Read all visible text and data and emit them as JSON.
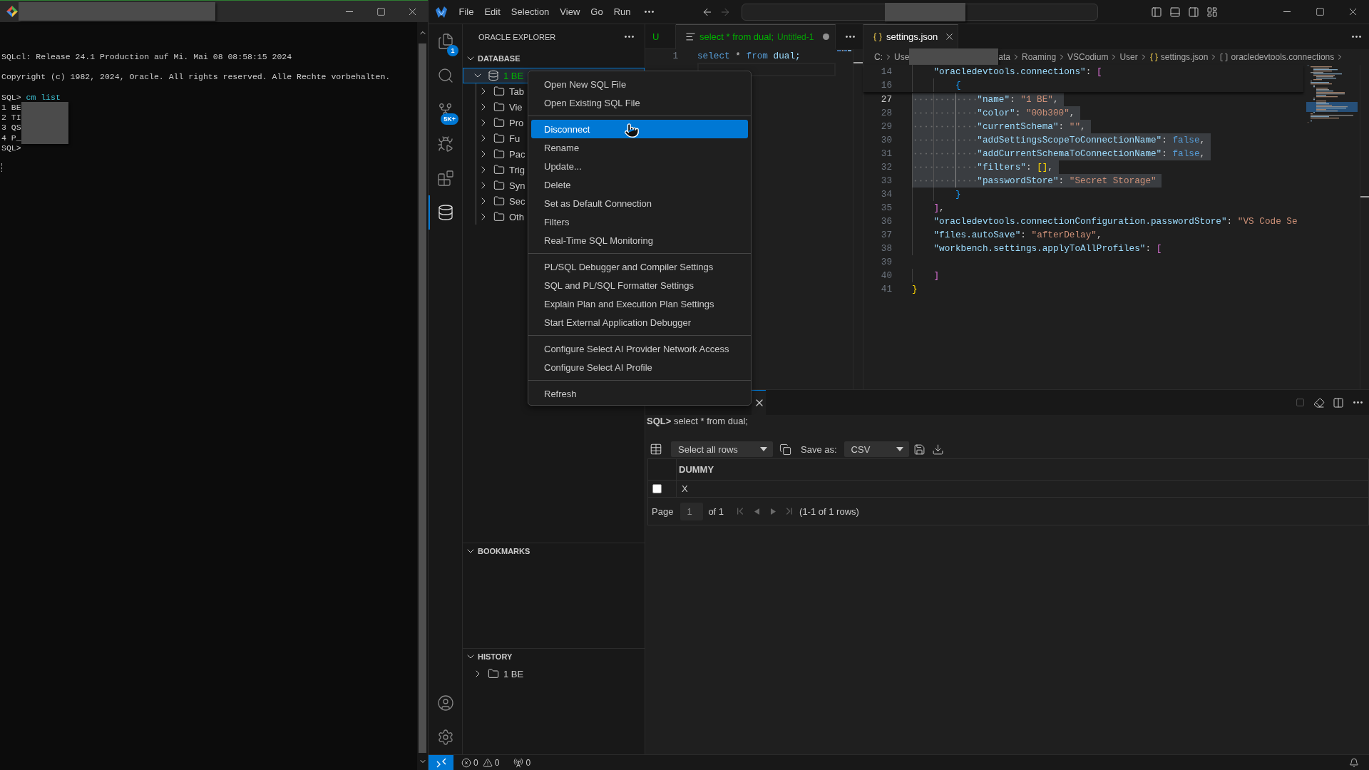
{
  "terminal": {
    "blocks": [
      {
        "lines": [
          {
            "kind": "output",
            "text": "SQLcl: Release 24.1 Production auf Mi. Mai 08 08:58:15 2024",
            "redacted": false
          }
        ]
      },
      {
        "lines": [
          {
            "kind": "output",
            "text": "Copyright (c) 1982, 2024, Oracle. All rights reserved. Alle Rechte vorbehalten.",
            "redacted": false
          }
        ]
      },
      {
        "lines": [
          {
            "kind": "prompt",
            "prompt": "SQL>",
            "command": "cm list",
            "redacted": false
          },
          {
            "kind": "output",
            "text": "1 BE",
            "redacted": true
          },
          {
            "kind": "output",
            "text": "2 TI",
            "redacted": true
          },
          {
            "kind": "output",
            "text": "3 QS",
            "redacted": true
          },
          {
            "kind": "output",
            "text": "4 P_",
            "redacted": true
          },
          {
            "kind": "prompt",
            "prompt": "SQL>",
            "redacted": false
          }
        ]
      }
    ]
  },
  "vscode": {
    "menu": [
      "File",
      "Edit",
      "Selection",
      "View",
      "Go",
      "Run"
    ],
    "activity_bar": [
      {
        "kind": "explorer",
        "badge": "1",
        "selected": false
      },
      {
        "kind": "search",
        "selected": false
      },
      {
        "kind": "source-control",
        "badge": "5K+",
        "selected": false
      },
      {
        "kind": "run-debug",
        "selected": false
      },
      {
        "kind": "extensions",
        "selected": false
      },
      {
        "kind": "database",
        "selected": true
      }
    ],
    "activity_bar_bottom": [
      {
        "kind": "account"
      },
      {
        "kind": "settings"
      }
    ],
    "sidebar": {
      "title": "ORACLE EXPLORER",
      "sections": [
        {
          "title": "DATABASE",
          "expanded": true,
          "tree": [
            {
              "kind": "connection",
              "label": "1 BE",
              "color": "#00b300",
              "selected": true,
              "expanded": true,
              "children": [
                {
                  "kind": "folder",
                  "label": "Tab",
                  "selected": false,
                  "expanded": false
                },
                {
                  "kind": "folder",
                  "label": "Vie",
                  "selected": false,
                  "expanded": false
                },
                {
                  "kind": "folder",
                  "label": "Pro",
                  "selected": false,
                  "expanded": false
                },
                {
                  "kind": "folder",
                  "label": "Fu",
                  "selected": false,
                  "expanded": false
                },
                {
                  "kind": "folder",
                  "label": "Pac",
                  "selected": false,
                  "expanded": false
                },
                {
                  "kind": "folder",
                  "label": "Trig",
                  "selected": false,
                  "expanded": false
                },
                {
                  "kind": "folder",
                  "label": "Syn",
                  "selected": false,
                  "expanded": false
                },
                {
                  "kind": "folder",
                  "label": "Sec",
                  "selected": false,
                  "expanded": false
                },
                {
                  "kind": "folder",
                  "label": "Oth",
                  "selected": false,
                  "expanded": false
                }
              ]
            }
          ]
        },
        {
          "title": "BOOKMARKS",
          "expanded": true
        },
        {
          "title": "HISTORY",
          "expanded": true,
          "tree": [
            {
              "kind": "folder",
              "label": "1 BE",
              "selected": false,
              "expanded": false
            }
          ]
        }
      ]
    },
    "context_menu": {
      "groups": [
        {
          "items": [
            {
              "label": "Open New SQL File",
              "selected": false
            },
            {
              "label": "Open Existing SQL File",
              "selected": false
            }
          ]
        },
        {
          "items": [
            {
              "label": "Disconnect",
              "selected": true
            },
            {
              "label": "Rename",
              "selected": false
            },
            {
              "label": "Update...",
              "selected": false
            },
            {
              "label": "Delete",
              "selected": false
            },
            {
              "label": "Set as Default Connection",
              "selected": false
            },
            {
              "label": "Filters",
              "selected": false
            },
            {
              "label": "Real-Time SQL Monitoring",
              "selected": false
            }
          ]
        },
        {
          "items": [
            {
              "label": "PL/SQL Debugger and Compiler Settings",
              "selected": false
            },
            {
              "label": "SQL and PL/SQL Formatter Settings",
              "selected": false
            },
            {
              "label": "Explain Plan and Execution Plan Settings",
              "selected": false
            },
            {
              "label": "Start External Application Debugger",
              "selected": false
            }
          ]
        },
        {
          "items": [
            {
              "label": "Configure Select AI Provider Network Access",
              "selected": false
            },
            {
              "label": "Configure Select AI Profile",
              "selected": false
            }
          ]
        },
        {
          "items": [
            {
              "label": "Refresh",
              "selected": false
            }
          ]
        }
      ]
    },
    "editor_groups": [
      {
        "tabs": [
          {
            "kind": "partial",
            "label": "U",
            "color": "#00b300",
            "selected": false
          },
          {
            "kind": "sql",
            "label": "select * from dual;",
            "description": "Untitled-1",
            "color": "#00b300",
            "selected": true,
            "modified": true
          }
        ],
        "lines": [
          {
            "number": "1",
            "current": false,
            "selected": false,
            "tokens": [
              {
                "kind": "keyword",
                "text": "select"
              },
              {
                "kind": "plain",
                "text": " * "
              },
              {
                "kind": "keyword",
                "text": "from"
              },
              {
                "kind": "ident",
                "text": " dual;"
              }
            ]
          },
          {
            "current": true,
            "selected": false
          }
        ]
      },
      {
        "tabs": [
          {
            "kind": "json",
            "label": "settings.json",
            "selected": true,
            "modified": false
          }
        ],
        "breadcrumbs": [
          {
            "kind": "folder",
            "label": "C:",
            "redacted": false
          },
          {
            "kind": "folder",
            "label": "Use",
            "redacted": true,
            "tail": "ata"
          },
          {
            "kind": "folder",
            "label": "Roaming",
            "redacted": false
          },
          {
            "kind": "folder",
            "label": "VSCodium",
            "redacted": false
          },
          {
            "kind": "folder",
            "label": "User",
            "redacted": false
          },
          {
            "kind": "json",
            "label": "settings.json",
            "redacted": false
          },
          {
            "kind": "array",
            "label": "oracledevtools.connections",
            "redacted": false
          }
        ],
        "sticky_lines": [
          {
            "number": "14",
            "current": false,
            "selected": false,
            "tokens": [
              {
                "kind": "key",
                "text": "    \"oracledevtools.connections\""
              },
              {
                "kind": "punct",
                "text": ": "
              },
              {
                "kind": "bracket2",
                "text": "["
              }
            ]
          },
          {
            "number": "16",
            "current": false,
            "selected": false,
            "tokens": [
              {
                "kind": "bracket3",
                "text": "        {"
              }
            ]
          }
        ],
        "lines": [
          {
            "number": "27",
            "current": true,
            "selected": true,
            "tokens": [
              {
                "kind": "key",
                "text": "            \"name\""
              },
              {
                "kind": "punct",
                "text": ": "
              },
              {
                "kind": "string",
                "text": "\"1 BE\""
              },
              {
                "kind": "punct",
                "text": ","
              }
            ]
          },
          {
            "number": "28",
            "current": false,
            "selected": true,
            "tokens": [
              {
                "kind": "key",
                "text": "            \"color\""
              },
              {
                "kind": "punct",
                "text": ": "
              },
              {
                "kind": "string",
                "text": "\"00b300\""
              },
              {
                "kind": "punct",
                "text": ","
              }
            ]
          },
          {
            "number": "29",
            "current": false,
            "selected": true,
            "tokens": [
              {
                "kind": "key",
                "text": "            \"currentSchema\""
              },
              {
                "kind": "punct",
                "text": ": "
              },
              {
                "kind": "string",
                "text": "\"\""
              },
              {
                "kind": "punct",
                "text": ","
              }
            ]
          },
          {
            "number": "30",
            "current": false,
            "selected": true,
            "tokens": [
              {
                "kind": "key",
                "text": "            \"addSettingsScopeToConnectionName\""
              },
              {
                "kind": "punct",
                "text": ": "
              },
              {
                "kind": "bool",
                "text": "false"
              },
              {
                "kind": "punct",
                "text": ","
              }
            ]
          },
          {
            "number": "31",
            "current": false,
            "selected": true,
            "tokens": [
              {
                "kind": "key",
                "text": "            \"addCurrentSchemaToConnectionName\""
              },
              {
                "kind": "punct",
                "text": ": "
              },
              {
                "kind": "bool",
                "text": "false"
              },
              {
                "kind": "punct",
                "text": ","
              }
            ]
          },
          {
            "number": "32",
            "current": false,
            "selected": true,
            "tokens": [
              {
                "kind": "key",
                "text": "            \"filters\""
              },
              {
                "kind": "punct",
                "text": ": "
              },
              {
                "kind": "bracket1",
                "text": "[]"
              },
              {
                "kind": "punct",
                "text": ","
              }
            ]
          },
          {
            "number": "33",
            "current": false,
            "selected": true,
            "tokens": [
              {
                "kind": "key",
                "text": "            \"passwordStore\""
              },
              {
                "kind": "punct",
                "text": ": "
              },
              {
                "kind": "string",
                "text": "\"Secret Storage\""
              }
            ]
          },
          {
            "number": "34",
            "current": false,
            "selected": false,
            "tokens": [
              {
                "kind": "bracket3",
                "text": "        }"
              }
            ]
          },
          {
            "number": "35",
            "current": false,
            "selected": false,
            "tokens": [
              {
                "kind": "bracket2",
                "text": "    ]"
              },
              {
                "kind": "punct",
                "text": ","
              }
            ]
          },
          {
            "number": "36",
            "current": false,
            "selected": false,
            "tokens": [
              {
                "kind": "key",
                "text": "    \"oracledevtools.connectionConfiguration.passwordStore\""
              },
              {
                "kind": "punct",
                "text": ": "
              },
              {
                "kind": "string",
                "text": "\"VS Code Se"
              }
            ]
          },
          {
            "number": "37",
            "current": false,
            "selected": false,
            "tokens": [
              {
                "kind": "key",
                "text": "    \"files.autoSave\""
              },
              {
                "kind": "punct",
                "text": ": "
              },
              {
                "kind": "string",
                "text": "\"afterDelay\""
              },
              {
                "kind": "punct",
                "text": ","
              }
            ]
          },
          {
            "number": "38",
            "current": false,
            "selected": false,
            "tokens": [
              {
                "kind": "key",
                "text": "    \"workbench.settings.applyToAllProfiles\""
              },
              {
                "kind": "punct",
                "text": ": "
              },
              {
                "kind": "bracket2",
                "text": "["
              }
            ]
          },
          {
            "number": "39",
            "current": false,
            "selected": false
          },
          {
            "number": "40",
            "current": false,
            "selected": false,
            "tokens": [
              {
                "kind": "bracket2",
                "text": "    ]"
              }
            ]
          },
          {
            "number": "41",
            "current": false,
            "selected": false,
            "tokens": [
              {
                "kind": "bracket1",
                "text": "}"
              }
            ]
          }
        ]
      }
    ],
    "panel": {
      "results_tab": {
        "selected": true
      },
      "actions": [
        {
          "kind": "stop",
          "disabled": true
        },
        {
          "kind": "clear",
          "disabled": false
        },
        {
          "kind": "split",
          "disabled": false
        },
        {
          "kind": "more",
          "disabled": false
        }
      ],
      "query": "**SQL>** select * from dual;",
      "toolbar": {
        "rows": "Select all rows",
        "save_label": "Save as:",
        "format": "CSV"
      },
      "table": {
        "columns": [
          "DUMMY"
        ],
        "rows": [
          {
            "checked": false,
            "cells": [
              "X"
            ]
          }
        ]
      },
      "pager": {
        "label": "Page",
        "page": "1",
        "total": "of 1",
        "summary": "(1-1 of 1 rows)"
      }
    },
    "status_bar": {
      "errors": "0",
      "warnings": "0",
      "ports": "0"
    }
  }
}
